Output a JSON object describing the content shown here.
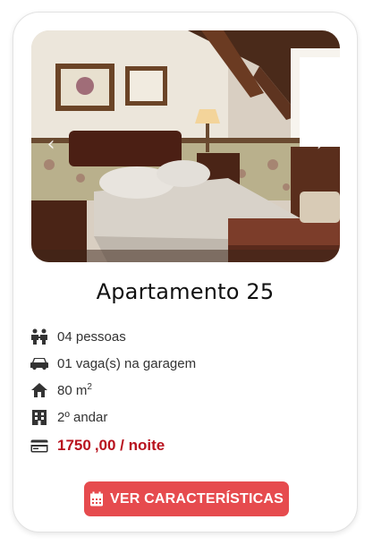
{
  "card": {
    "title": "Apartamento 25",
    "features": {
      "people": "04 pessoas",
      "parking": "01 vaga(s) na garagem",
      "area_value": "80 m",
      "area_unit_exp": "2",
      "floor": "2º andar"
    },
    "price": {
      "amount": "1750",
      "cents": ",00 / noite"
    },
    "button_label": "VER CARACTERÍSTICAS"
  },
  "icons": {
    "prev": "chevron-left-icon",
    "next": "chevron-right-icon",
    "people": "people-icon",
    "car": "car-icon",
    "home": "home-icon",
    "building": "building-icon",
    "card": "credit-card-icon",
    "calendar": "calendar-icon"
  },
  "colors": {
    "price": "#b8121e",
    "button": "#e64b4e"
  }
}
